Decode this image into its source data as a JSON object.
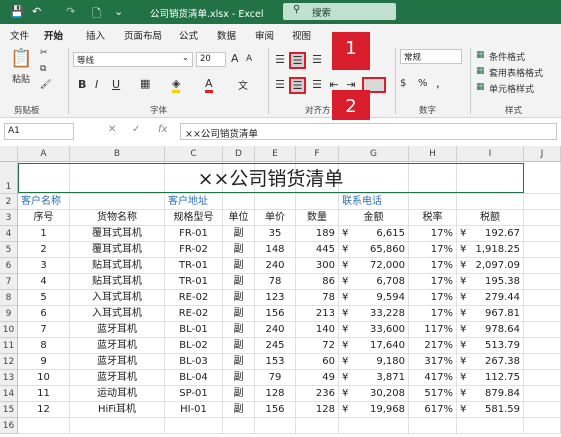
{
  "titlebar": {
    "save_icon": "💾",
    "undo_icon": "↶",
    "redo_icon": "↷",
    "new_icon": "🗋",
    "more_icon": "⌄",
    "title": "公司销货清单.xlsx  -  Excel",
    "search_placeholder": "搜索"
  },
  "tabs": [
    "文件",
    "开始",
    "插入",
    "页面布局",
    "公式",
    "数据",
    "审阅",
    "视图"
  ],
  "ribbon": {
    "paste": "粘贴",
    "clipboard": "剪贴板",
    "font_name": "等线",
    "font_size": "20",
    "font_group": "字体",
    "align_group": "对齐方",
    "number_format": "常规",
    "number_group": "数字",
    "cond_format": "条件格式",
    "table_format": "套用表格格式",
    "cell_style": "单元格样式",
    "style_group": "样式",
    "bold": "B",
    "italic": "I",
    "underline": "U",
    "font_a": "A",
    "font_a_small": "A",
    "percent": "%",
    "comma": ",",
    "dollar": "$"
  },
  "callouts": {
    "one": "1",
    "two": "2"
  },
  "formula": {
    "namebox": "A1",
    "fx": "fx",
    "content": "××公司销货清单"
  },
  "columns": [
    "A",
    "B",
    "C",
    "D",
    "E",
    "F",
    "G",
    "H",
    "I",
    "J"
  ],
  "rows": [
    "1",
    "2",
    "3",
    "4",
    "5",
    "6",
    "7",
    "8",
    "9",
    "10",
    "11",
    "12",
    "13",
    "14",
    "15",
    "16"
  ],
  "sheet": {
    "title": "××公司销货清单",
    "customer_name": "客户名称",
    "customer_addr": "客户地址",
    "contact_phone": "联系电话",
    "headers": [
      "序号",
      "货物名称",
      "规格型号",
      "单位",
      "单价",
      "数量",
      "金额",
      "税率",
      "税额"
    ],
    "data": [
      [
        "1",
        "覆耳式耳机",
        "FR-01",
        "副",
        "35",
        "189",
        "¥",
        "6,615",
        "17%",
        "¥",
        "192.67"
      ],
      [
        "2",
        "覆耳式耳机",
        "FR-02",
        "副",
        "148",
        "445",
        "¥",
        "65,860",
        "17%",
        "¥",
        "1,918.25"
      ],
      [
        "3",
        "贴耳式耳机",
        "TR-01",
        "副",
        "240",
        "300",
        "¥",
        "72,000",
        "17%",
        "¥",
        "2,097.09"
      ],
      [
        "4",
        "贴耳式耳机",
        "TR-01",
        "副",
        "78",
        "86",
        "¥",
        "6,708",
        "17%",
        "¥",
        "195.38"
      ],
      [
        "5",
        "入耳式耳机",
        "RE-02",
        "副",
        "123",
        "78",
        "¥",
        "9,594",
        "17%",
        "¥",
        "279.44"
      ],
      [
        "6",
        "入耳式耳机",
        "RE-02",
        "副",
        "156",
        "213",
        "¥",
        "33,228",
        "17%",
        "¥",
        "967.81"
      ],
      [
        "7",
        "蓝牙耳机",
        "BL-01",
        "副",
        "240",
        "140",
        "¥",
        "33,600",
        "117%",
        "¥",
        "978.64"
      ],
      [
        "8",
        "蓝牙耳机",
        "BL-02",
        "副",
        "245",
        "72",
        "¥",
        "17,640",
        "217%",
        "¥",
        "513.79"
      ],
      [
        "9",
        "蓝牙耳机",
        "BL-03",
        "副",
        "153",
        "60",
        "¥",
        "9,180",
        "317%",
        "¥",
        "267.38"
      ],
      [
        "10",
        "蓝牙耳机",
        "BL-04",
        "副",
        "79",
        "49",
        "¥",
        "3,871",
        "417%",
        "¥",
        "112.75"
      ],
      [
        "11",
        "运动耳机",
        "SP-01",
        "副",
        "128",
        "236",
        "¥",
        "30,208",
        "517%",
        "¥",
        "879.84"
      ],
      [
        "12",
        "HiFi耳机",
        "HI-01",
        "副",
        "156",
        "128",
        "¥",
        "19,968",
        "617%",
        "¥",
        "581.59"
      ]
    ]
  }
}
